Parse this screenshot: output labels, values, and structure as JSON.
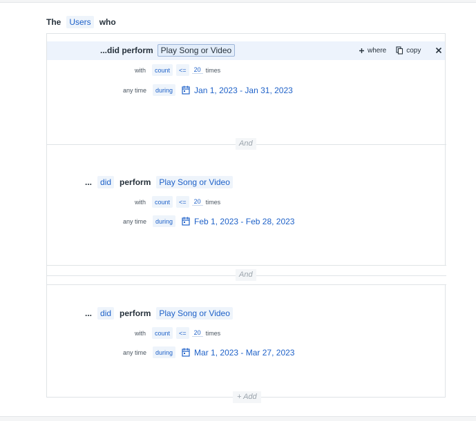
{
  "header": {
    "the": "The",
    "entity": "Users",
    "who": "who"
  },
  "blocks": [
    {
      "prefix": "...did perform",
      "event": "Play Song or Video",
      "with_label": "with",
      "metric": "count",
      "operator": "<=",
      "value": "20",
      "unit": "times",
      "time_label": "any time",
      "during": "during",
      "date_range": "Jan 1, 2023 - Jan 31, 2023"
    },
    {
      "ellipsis": "...",
      "did": "did",
      "perform": "perform",
      "event": "Play Song or Video",
      "with_label": "with",
      "metric": "count",
      "operator": "<=",
      "value": "20",
      "unit": "times",
      "time_label": "any time",
      "during": "during",
      "date_range": "Feb 1, 2023 - Feb 28, 2023"
    },
    {
      "ellipsis": "...",
      "did": "did",
      "perform": "perform",
      "event": "Play Song or Video",
      "with_label": "with",
      "metric": "count",
      "operator": "<=",
      "value": "20",
      "unit": "times",
      "time_label": "any time",
      "during": "during",
      "date_range": "Mar 1, 2023 - Mar 27, 2023"
    }
  ],
  "actions": {
    "where": "where",
    "copy": "copy"
  },
  "joiners": [
    "And",
    "And"
  ],
  "add_label": "+ Add",
  "icons": {
    "calendar": "calendar-icon",
    "plus": "plus-icon",
    "copy": "copy-icon",
    "close": "close-icon"
  },
  "colors": {
    "accent": "#1e61c8",
    "chip_bg": "#eef4fb",
    "selected_bg": "#edf3fc"
  }
}
